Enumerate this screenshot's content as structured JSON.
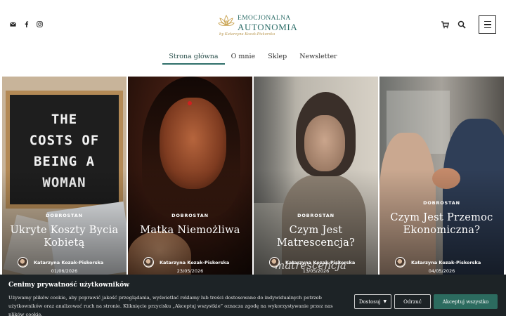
{
  "header": {
    "logo": {
      "line1": "EMOCJONALNA",
      "line2": "AUTONOMIA",
      "line3": "by Katarzyna Kozak-Piskorska"
    },
    "social_icons": [
      "mail-icon",
      "facebook-icon",
      "instagram-icon"
    ],
    "tool_icons": [
      "cart-icon",
      "search-icon",
      "menu-icon"
    ]
  },
  "nav": {
    "items": [
      {
        "label": "Strona główna",
        "active": true
      },
      {
        "label": "O mnie",
        "active": false
      },
      {
        "label": "Sklep",
        "active": false
      },
      {
        "label": "Newsletter",
        "active": false
      }
    ]
  },
  "cards": [
    {
      "image_text": "THE COSTS OF BEING A WOMAN",
      "category": "DOBROSTAN",
      "title": "Ukryte Koszty Bycia Kobietą",
      "author": "Katarzyna Kozak-Piskorska",
      "date": "01/06/2026"
    },
    {
      "category": "DOBROSTAN",
      "title": "Matka Niemożliwa",
      "author": "Katarzyna Kozak-Piskorska",
      "date": "23/05/2026"
    },
    {
      "image_text": "matrescencja",
      "category": "DOBROSTAN",
      "title": "Czym Jest Matrescencja?",
      "author": "Katarzyna Kozak-Piskorska",
      "date": "13/05/2026"
    },
    {
      "category": "DOBROSTAN",
      "title": "Czym Jest Przemoc Ekonomiczna?",
      "author": "Katarzyna Kozak-Piskorska",
      "date": "04/05/2026"
    }
  ],
  "cookie": {
    "title": "Cenimy prywatność użytkowników",
    "description": "Używamy plików cookie, aby poprawić jakość przeglądania, wyświetlać reklamy lub treści dostosowane do indywidualnych potrzeb użytkowników oraz analizować ruch na stronie. Kliknięcie przycisku „Akceptuj wszystkie” oznacza zgodę na wykorzystywanie przez nas plików cookie.",
    "customize_label": "Dostosuj",
    "reject_label": "Odrzuć",
    "accept_label": "Akceptuj wszystko",
    "accept_color": "#2c6b5f"
  }
}
